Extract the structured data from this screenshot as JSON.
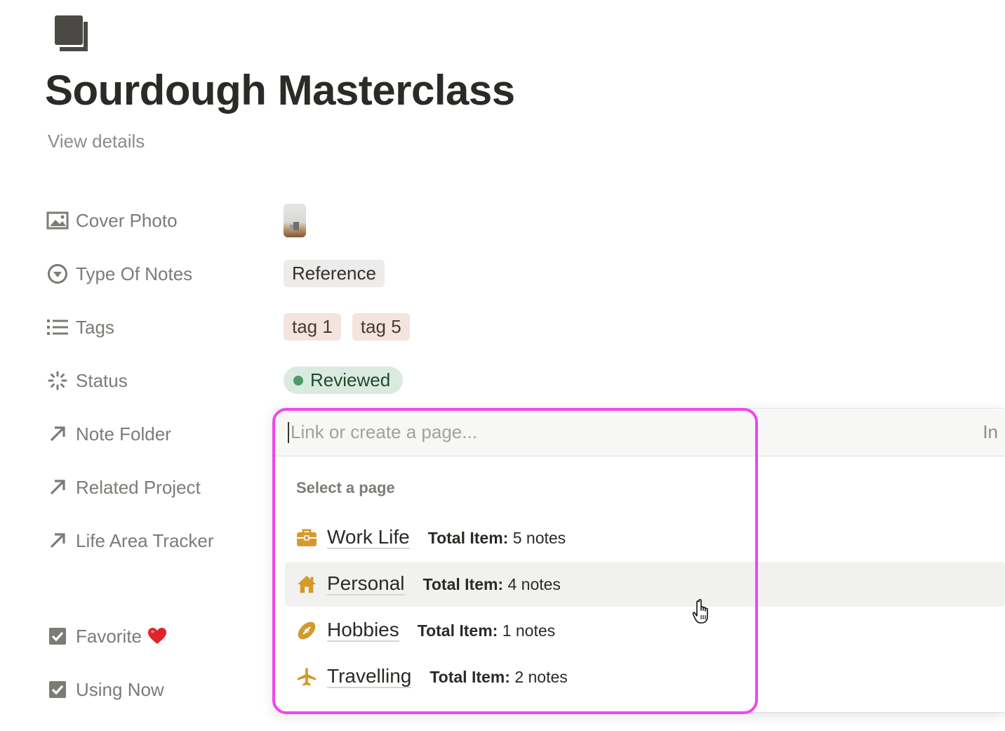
{
  "page": {
    "icon": "document-icon",
    "title": "Sourdough Masterclass",
    "view_details": "View details"
  },
  "properties": {
    "cover_photo": {
      "label": "Cover Photo",
      "icon": "image-icon"
    },
    "type_of_notes": {
      "label": "Type Of Notes",
      "icon": "select-icon",
      "value": "Reference"
    },
    "tags": {
      "label": "Tags",
      "icon": "list-icon",
      "values": [
        "tag 1",
        "tag 5"
      ]
    },
    "status": {
      "label": "Status",
      "icon": "status-icon",
      "value": "Reviewed",
      "color": "#4d9b67"
    },
    "note_folder": {
      "label": "Note Folder",
      "icon": "relation-arrow-icon"
    },
    "related_project": {
      "label": "Related Project",
      "icon": "relation-arrow-icon"
    },
    "life_area_tracker": {
      "label": "Life Area Tracker",
      "icon": "relation-arrow-icon"
    },
    "favorite": {
      "label": "Favorite",
      "icon": "checkbox-icon",
      "emoji": "heart-emoji"
    },
    "using_now": {
      "label": "Using Now",
      "icon": "checkbox-icon"
    }
  },
  "popup": {
    "search_placeholder": "Link or create a page...",
    "search_value": "",
    "suffix": "In",
    "section_label": "Select a page",
    "meta_label": "Total Item:",
    "options": [
      {
        "title": "Work Life",
        "icon": "briefcase-icon",
        "meta_value": "5 notes"
      },
      {
        "title": "Personal",
        "icon": "house-icon",
        "meta_value": "4 notes",
        "hovered": true
      },
      {
        "title": "Hobbies",
        "icon": "football-icon",
        "meta_value": "1 notes"
      },
      {
        "title": "Travelling",
        "icon": "airplane-icon",
        "meta_value": "2 notes"
      }
    ],
    "icon_color": "#d49a2e",
    "highlight_color": "#f046f0"
  }
}
